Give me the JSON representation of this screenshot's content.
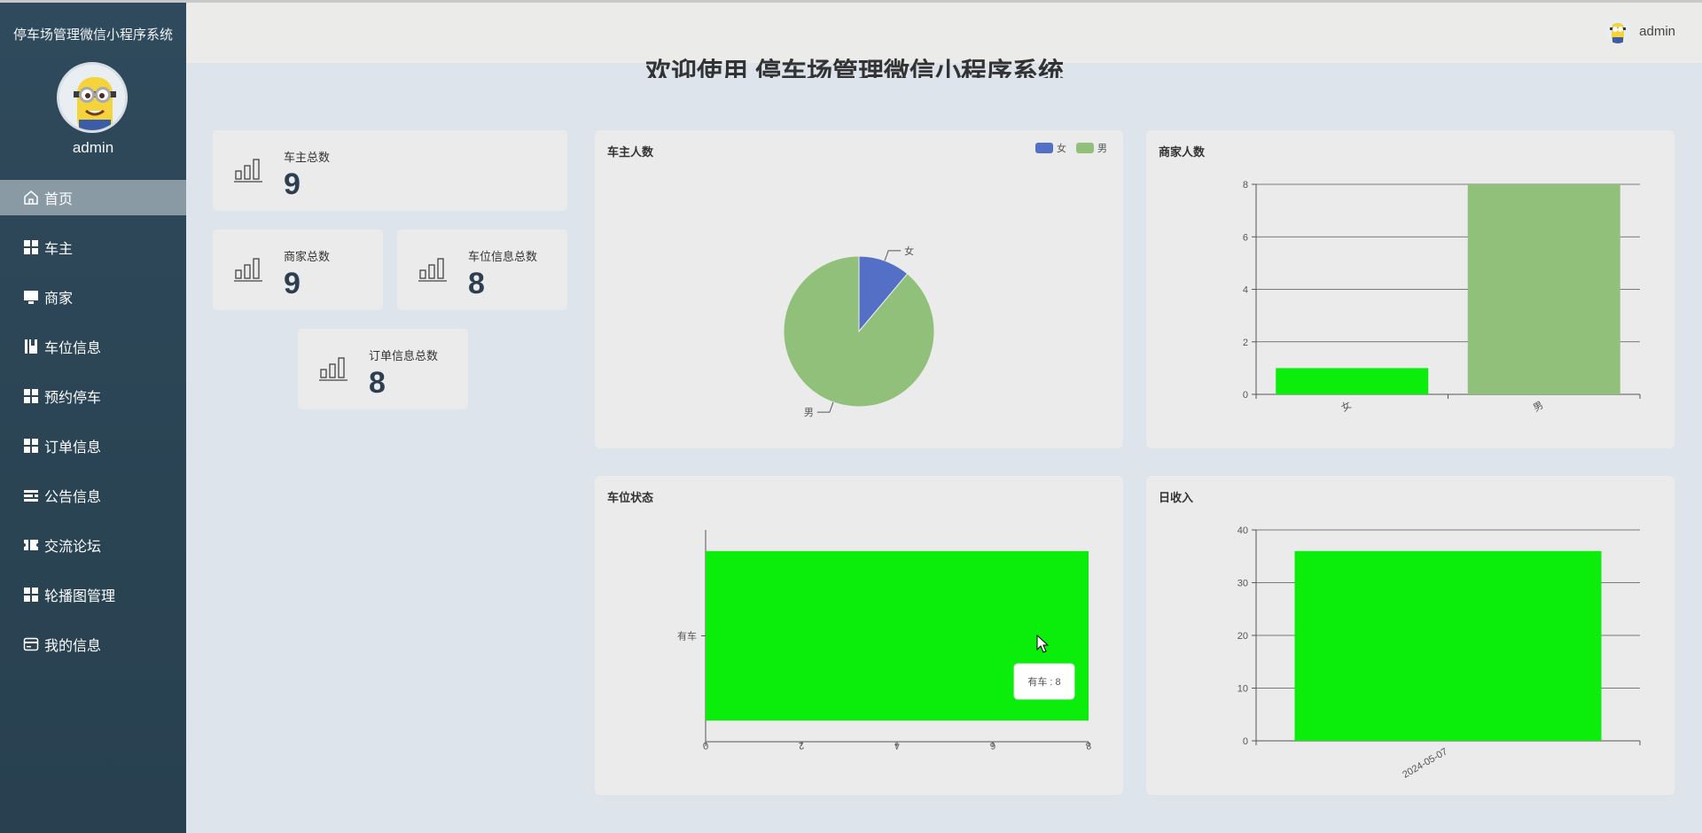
{
  "app": {
    "title": "停车场管理微信小程序系统",
    "username": "admin"
  },
  "header": {
    "username": "admin"
  },
  "welcome": "欢迎使用 停车场管理微信小程序系统",
  "menu": [
    {
      "label": "首页",
      "icon": "home-icon",
      "active": true
    },
    {
      "label": "车主",
      "icon": "grid-icon"
    },
    {
      "label": "商家",
      "icon": "monitor-icon"
    },
    {
      "label": "车位信息",
      "icon": "book-icon"
    },
    {
      "label": "预约停车",
      "icon": "grid-icon"
    },
    {
      "label": "订单信息",
      "icon": "grid-icon"
    },
    {
      "label": "公告信息",
      "icon": "list-icon"
    },
    {
      "label": "交流论坛",
      "icon": "ticket-icon"
    },
    {
      "label": "轮播图管理",
      "icon": "grid-icon"
    },
    {
      "label": "我的信息",
      "icon": "card-icon"
    }
  ],
  "stats": [
    {
      "label": "车主总数",
      "value": "9"
    },
    {
      "label": "商家总数",
      "value": "9"
    },
    {
      "label": "车位信息总数",
      "value": "8"
    },
    {
      "label": "订单信息总数",
      "value": "8"
    }
  ],
  "chart_data": [
    {
      "type": "pie",
      "title": "车主人数",
      "labels": [
        "女",
        "男"
      ],
      "values": [
        1,
        8
      ],
      "colors": [
        "#5470c6",
        "#91c07a"
      ],
      "legend": "top-right"
    },
    {
      "type": "bar",
      "title": "商家人数",
      "categories": [
        "女",
        "男"
      ],
      "values": [
        1,
        8
      ],
      "colors": [
        "#0bee0b",
        "#91c07a"
      ],
      "ylim": [
        0,
        8
      ],
      "yticks": [
        "0",
        "2",
        "4",
        "6",
        "8"
      ],
      "grid": true
    },
    {
      "type": "bar",
      "orientation": "horizontal",
      "title": "车位状态",
      "categories": [
        "有车"
      ],
      "values": [
        8
      ],
      "color": "#0bee0b",
      "xlim": [
        0,
        8
      ],
      "xticks": [
        "0",
        "2",
        "4",
        "6",
        "8"
      ],
      "tooltip": "有车 : 8"
    },
    {
      "type": "bar",
      "title": "日收入",
      "categories": [
        "2024-05-07"
      ],
      "values": [
        36
      ],
      "color": "#0bee0b",
      "ylim": [
        0,
        40
      ],
      "yticks": [
        "0",
        "10",
        "20",
        "30",
        "40"
      ],
      "grid": true
    }
  ]
}
